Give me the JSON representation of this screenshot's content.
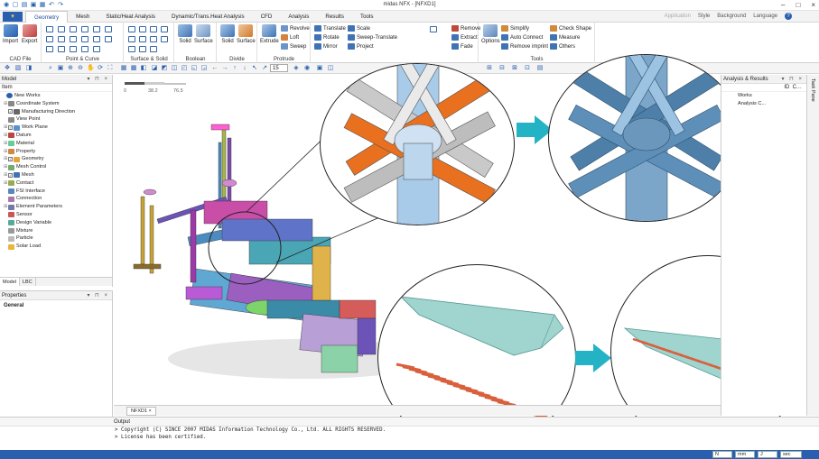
{
  "window": {
    "title": "midas NFX - [NFXD1]",
    "buttons": [
      "–",
      "□",
      "×"
    ]
  },
  "menu": {
    "tabs": [
      "Geometry",
      "Mesh",
      "Static/Heat Analysis",
      "Dynamic/Trans.Heat Analysis",
      "CFD",
      "Analysis",
      "Results",
      "Tools"
    ],
    "active": "Geometry",
    "right": [
      "Application",
      "Style",
      "Background",
      "Language"
    ]
  },
  "ribbon": {
    "cad_file": {
      "label": "CAD File",
      "import": "Import",
      "export": "Export"
    },
    "point_curve": {
      "label": "Point & Curve"
    },
    "surface_solid": {
      "label": "Surface & Solid"
    },
    "boolean": {
      "label": "Boolean",
      "solid": "Solid",
      "surface": "Surface"
    },
    "divide": {
      "label": "Divide",
      "solid": "Solid",
      "surface": "Surface"
    },
    "protrude": {
      "label": "Protrude",
      "extrude": "Extrude",
      "revolve": "Revolve",
      "loft": "Loft",
      "sweep": "Sweep"
    },
    "transform": {
      "translate": "Translate",
      "rotate": "Rotate",
      "mirror": "Mirror",
      "scale": "Scale",
      "sweep_translate": "Sweep-Translate",
      "project": "Project"
    },
    "feature": {
      "remove": "Remove",
      "extract": "Extract",
      "fade": "Fade"
    },
    "tools": {
      "label": "Tools",
      "options": "Options",
      "simplify": "Simplify",
      "auto_connect": "Auto Connect",
      "remove_imprint": "Remove imprint",
      "check_shape": "Check Shape",
      "measure": "Measure",
      "others": "Others"
    }
  },
  "toolbar": {
    "zoom": "15"
  },
  "model_panel": {
    "title": "Model",
    "column": "Item",
    "items": [
      "New Works",
      "Coordinate System",
      "Manufacturing Direction",
      "View Point",
      "Work Plane",
      "Datum",
      "Material",
      "Property",
      "Geometry",
      "Mesh Control",
      "Mesh",
      "Contact",
      "FSI Interface",
      "Connection",
      "Element Parameters",
      "Sensor",
      "Design Variable",
      "Mixture",
      "Particle",
      "Solar Load"
    ],
    "tabs": [
      "Model",
      "LBC"
    ]
  },
  "properties_panel": {
    "title": "Properties",
    "general": "General"
  },
  "right_panel": {
    "title": "Analysis & Results",
    "col_id": "ID",
    "col_c": "C...",
    "items": [
      "Works",
      "Analysis C..."
    ]
  },
  "task_pane": "Task Pane",
  "viewport": {
    "scale_labels": [
      "0",
      "38.2",
      "76.5"
    ],
    "doc_tab": "NFXD1"
  },
  "output": {
    "title": "Output",
    "lines": [
      "> Copyright (C) SINCE 2007 MIDAS Information Technology Co., Ltd. ALL RIGHTS RESERVED.",
      "> License has been certified."
    ]
  },
  "status": {
    "unit_force": "N",
    "unit_length": "mm",
    "unit_energy": "J",
    "unit_time": "sec"
  },
  "colors": {
    "accent": "#2a5fb0",
    "orange": "#e8701e",
    "steel": "#4d7fa8",
    "teal": "#9fd4cf",
    "arrow": "#23b3c4",
    "red_bars": "#d9603c"
  }
}
